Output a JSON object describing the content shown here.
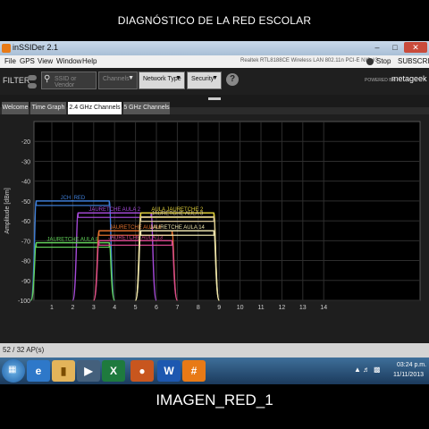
{
  "top_caption": "DIAGNÓSTICO DE LA RED ESCOLAR",
  "bottom_caption": "IMAGEN_RED_1",
  "window": {
    "title": "inSSIDer 2.1",
    "controls": {
      "minimize": "–",
      "maximize": "□",
      "close": "✕"
    }
  },
  "menu": {
    "file": "File",
    "gps": "GPS",
    "view": "View",
    "window": "Window",
    "help": "Help",
    "adapter": "Realtek RTL8188CE Wireless LAN 802.11n PCI-E NIC #3",
    "stop": "Stop",
    "subscribe": "SUBSCRIBE"
  },
  "filter": {
    "label": "FILTER",
    "search_placeholder": "SSID or Vendor",
    "channels": "Channels",
    "network_type": "Network Type",
    "security": "Security",
    "help": "?",
    "powered_by": "POWERED BY",
    "brand": "metageek"
  },
  "tabs": [
    {
      "label": "Welcome",
      "active": false
    },
    {
      "label": "Time Graph",
      "active": false
    },
    {
      "label": "2.4 GHz Channels",
      "active": true
    },
    {
      "label": "5 GHz Channels",
      "active": false
    }
  ],
  "status": "52 / 32 AP(s)",
  "taskbar": {
    "time": "03:24 p.m.",
    "date": "11/11/2013"
  },
  "icons": {
    "search": "search-icon",
    "start": "windows-start-icon",
    "apps": [
      "internet-explorer-icon",
      "file-explorer-icon",
      "media-player-icon",
      "excel-icon",
      "firefox-icon",
      "word-icon",
      "inssider-icon"
    ]
  },
  "chart_data": {
    "type": "area",
    "ylabel": "Amplitude [dBm]",
    "ylim": [
      -100,
      -10
    ],
    "yticks": [
      -20,
      -30,
      -40,
      -50,
      -60,
      -70,
      -80,
      -90,
      -100
    ],
    "xticks": [
      1,
      2,
      3,
      4,
      5,
      6,
      7,
      8,
      9,
      10,
      11,
      12,
      13,
      14
    ],
    "grid": true,
    "series": [
      {
        "name": "JCH_RED",
        "start": 0,
        "end": 4,
        "rssi": -50,
        "color": "#3f7fd9"
      },
      {
        "name": "JAURETCHE AULA 2",
        "start": 2,
        "end": 6,
        "rssi": -56,
        "color": "#a64ad9"
      },
      {
        "name": "JAURETCHE AULA 8",
        "start": 0,
        "end": 4,
        "rssi": -71,
        "color": "#62d25a"
      },
      {
        "name": "JAURETCHE AULA 6",
        "start": 3,
        "end": 7,
        "rssi": -65,
        "color": "#e6732e"
      },
      {
        "name": "JAURETCHE AULA 13",
        "start": 3,
        "end": 7,
        "rssi": -70,
        "color": "#d94a8f"
      },
      {
        "name": "AULA JAURETCHE 2",
        "start": 5,
        "end": 9,
        "rssi": -56,
        "color": "#e0d03a"
      },
      {
        "name": "JAURETCHE AULA 3",
        "start": 5,
        "end": 9,
        "rssi": -58,
        "color": "#d9c99a"
      },
      {
        "name": "JAURETCHE AULA 14",
        "start": 5,
        "end": 9,
        "rssi": -65,
        "color": "#f0e8b0"
      }
    ]
  }
}
